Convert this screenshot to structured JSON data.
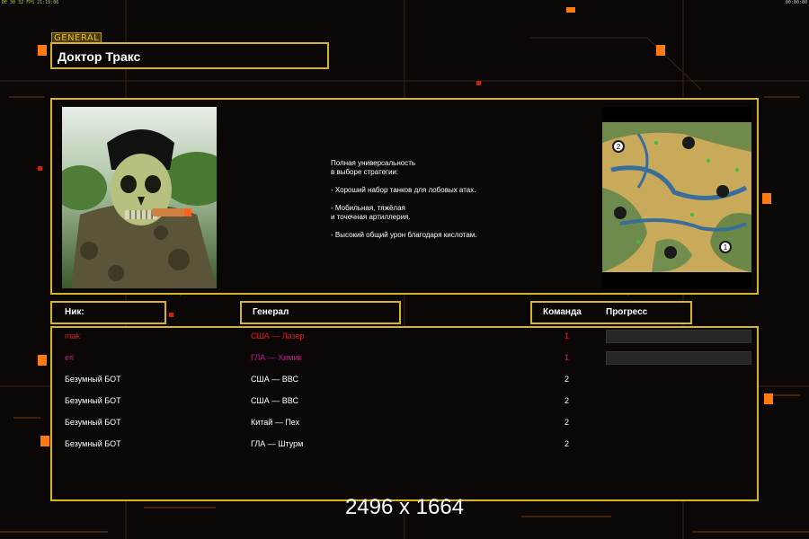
{
  "hud": {
    "top_left": "DE 30 32 FPS 21:19:06",
    "top_right": "00:00:00"
  },
  "section_tag": "GENERAL",
  "general": {
    "name": "Доктор Тракс",
    "description": "Полная универсальность\nв выборе стратегии:\n\n- Хороший набор танков для лобовых атах.\n\n- Мобильная, тяжёлая\nи точечная артиллерия.\n\n- Высокий общий урон благодаря кислотам.",
    "portrait_icon": "skull-mask-portrait",
    "map_icon": "minimap",
    "map_markers": [
      "2",
      "1"
    ]
  },
  "table": {
    "headers": {
      "nick": "Ник:",
      "general": "Генерал",
      "team": "Команда",
      "progress": "Прогресс"
    },
    "rows": [
      {
        "name": "mak",
        "general": "США — Лазер",
        "team": "1",
        "color": "#e0182e",
        "progress": 0.0
      },
      {
        "name": "eri",
        "general": "ГЛА — Химик",
        "team": "1",
        "color": "#c0188c",
        "progress": 0.0
      },
      {
        "name": "Безумный БОТ",
        "general": "США — ВВС",
        "team": "2",
        "color": "#ffffff"
      },
      {
        "name": "Безумный БОТ",
        "general": "США — ВВС",
        "team": "2",
        "color": "#ffffff"
      },
      {
        "name": "Безумный БОТ",
        "general": "Китай — Пех",
        "team": "2",
        "color": "#ffffff"
      },
      {
        "name": "Безумный БОТ",
        "general": "ГЛА — Штурм",
        "team": "2",
        "color": "#ffffff"
      }
    ]
  },
  "watermark": "2496 x 1664",
  "colors": {
    "frame": "#d6b422",
    "accent_orange": "#ff7a10",
    "background": "#0b0706"
  }
}
